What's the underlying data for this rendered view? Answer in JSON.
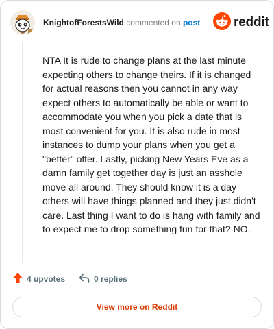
{
  "header": {
    "username": "KnightofForestsWild",
    "action_text": "commented on",
    "post_link": "post",
    "brand": "reddit"
  },
  "comment": {
    "text": "NTA It is rude to change plans at the last minute expecting others to change theirs. If it is changed for actual reasons then you cannot in any way expect others to automatically be able or want to accommodate you when you pick a date that is most convenient for you. It is also rude in most instances to dump your plans when you get a \"better\" offer. Lastly, picking New Years Eve as a damn family get together day is just an asshole move all around. They should know it is a day others will have things planned and they just didn't care. Last thing I want to do is hang with family and to expect me to drop something fun for that? NO."
  },
  "actions": {
    "upvotes": "4 upvotes",
    "replies": "0 replies"
  },
  "footer": {
    "view_more": "View more on Reddit"
  },
  "colors": {
    "brand_orange": "#ff4500",
    "link_blue": "#0079d3",
    "view_more_text": "#d93a00"
  },
  "icons": {
    "upvote": "upvote-arrow-icon",
    "reply": "reply-icon",
    "brand": "reddit-snoo-icon"
  }
}
